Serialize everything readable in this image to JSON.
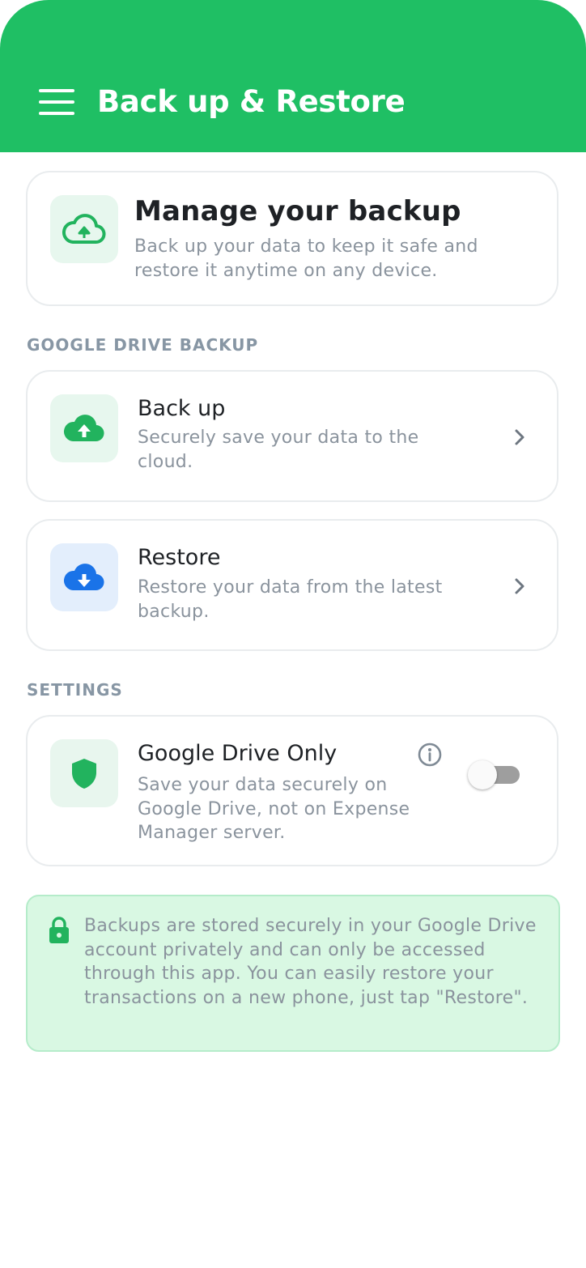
{
  "app_bar": {
    "title": "Back up & Restore",
    "menu_icon": "hamburger-menu-icon",
    "color": "#1fbf64"
  },
  "header_card": {
    "icon": "cloud-upload-outline-icon",
    "title": "Manage your backup",
    "description": "Back up your data to keep it safe and restore it anytime on any device."
  },
  "sections": {
    "google_drive_backup": "GOOGLE DRIVE BACKUP",
    "settings": "SETTINGS"
  },
  "backup_item": {
    "icon": "cloud-upload-icon",
    "title": "Back up",
    "description": "Securely save your data to the cloud."
  },
  "restore_item": {
    "icon": "cloud-download-icon",
    "title": "Restore",
    "description": "Restore your data from the latest backup."
  },
  "drive_only_setting": {
    "icon": "shield-icon",
    "title": "Google Drive Only",
    "description": "Save your data securely on Google Drive, not on Expense Manager server.",
    "info_icon": "info-icon",
    "enabled": false
  },
  "note": {
    "icon": "lock-icon",
    "text": "Backups are stored securely in your Google Drive account privately and can only be accessed through this app. You can easily restore your transactions on a new phone, just tap \"Restore\"."
  },
  "colors": {
    "accent_green": "#1fbf64",
    "icon_green": "#22b35e",
    "icon_blue": "#1a73e8",
    "note_background": "#d9f8e3"
  }
}
